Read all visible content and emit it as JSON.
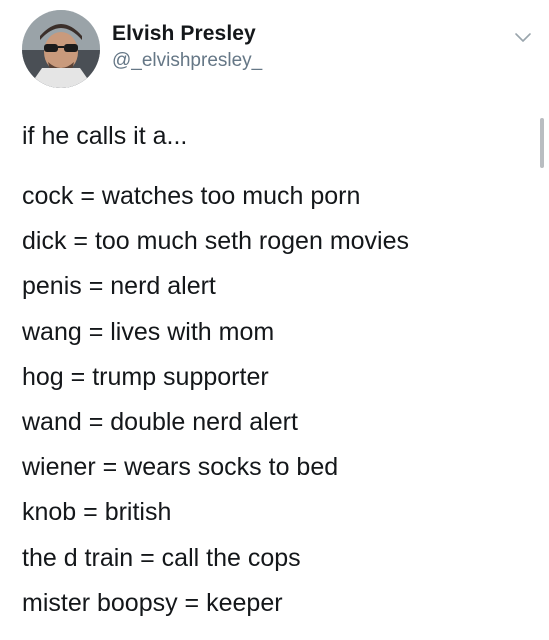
{
  "user": {
    "display_name": "Elvish Presley",
    "handle": "@_elvishpresley_"
  },
  "icons": {
    "avatar": "avatar-photo",
    "menu": "chevron-down-icon"
  },
  "tweet": {
    "intro": "if he calls it a...",
    "lines": [
      "cock = watches too much porn",
      "dick = too much seth rogen movies",
      "penis = nerd alert",
      "wang = lives with mom",
      "hog = trump supporter",
      "wand = double nerd alert",
      "wiener = wears socks to bed",
      "knob = british",
      "the d train = call the cops",
      "mister boopsy = keeper"
    ]
  },
  "colors": {
    "text": "#14171a",
    "secondary": "#657786",
    "background": "#ffffff"
  }
}
